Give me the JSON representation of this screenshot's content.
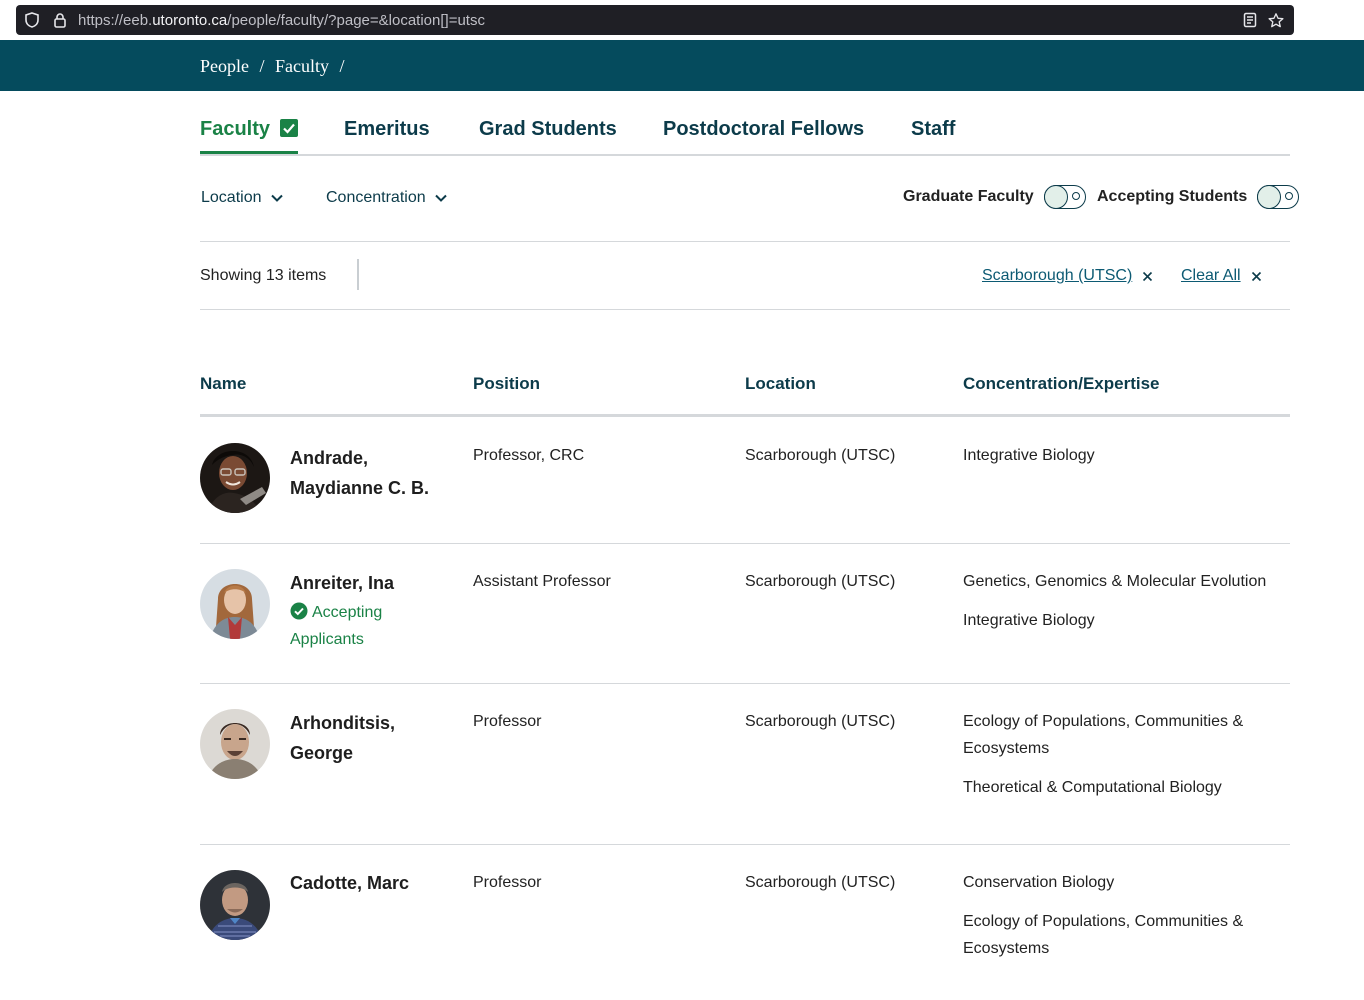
{
  "browser": {
    "url_prefix": "https://eeb.",
    "url_host": "utoronto.ca",
    "url_path": "/people/faculty/?page=&location[]=utsc"
  },
  "breadcrumb": [
    "People",
    "/",
    "Faculty",
    "/"
  ],
  "tabs": [
    {
      "label": "Faculty",
      "active": true
    },
    {
      "label": "Emeritus"
    },
    {
      "label": "Grad Students"
    },
    {
      "label": "Postdoctoral Fellows"
    },
    {
      "label": "Staff"
    }
  ],
  "filters": {
    "location_label": "Location",
    "concentration_label": "Concentration",
    "graduate_faculty_label": "Graduate Faculty",
    "accepting_students_label": "Accepting Students"
  },
  "results": {
    "showing_text": "Showing 13 items",
    "active_filter": "Scarborough (UTSC)",
    "clear_all": "Clear All"
  },
  "table": {
    "headers": [
      "Name",
      "Position",
      "Location",
      "Concentration/Expertise"
    ],
    "rows": [
      {
        "name": "Andrade, Maydianne C. B.",
        "position": "Professor, CRC",
        "location": "Scarborough (UTSC)",
        "concentrations": [
          "Integrative Biology"
        ]
      },
      {
        "name": "Anreiter, Ina",
        "accepting": "Accepting Applicants",
        "position": "Assistant Professor",
        "location": "Scarborough (UTSC)",
        "concentrations": [
          "Genetics, Genomics & Molecular Evolution",
          "Integrative Biology"
        ]
      },
      {
        "name": "Arhonditsis, George",
        "position": "Professor",
        "location": "Scarborough (UTSC)",
        "concentrations": [
          "Ecology of Populations, Communities & Ecosystems",
          "Theoretical & Computational Biology"
        ]
      },
      {
        "name": "Cadotte, Marc",
        "position": "Professor",
        "location": "Scarborough (UTSC)",
        "concentrations": [
          "Conservation Biology",
          "Ecology of Populations, Communities & Ecosystems"
        ]
      }
    ]
  },
  "colors": {
    "brand_dark": "#054b5d",
    "accent_green": "#1a8246",
    "heading": "#0c3b4a"
  }
}
